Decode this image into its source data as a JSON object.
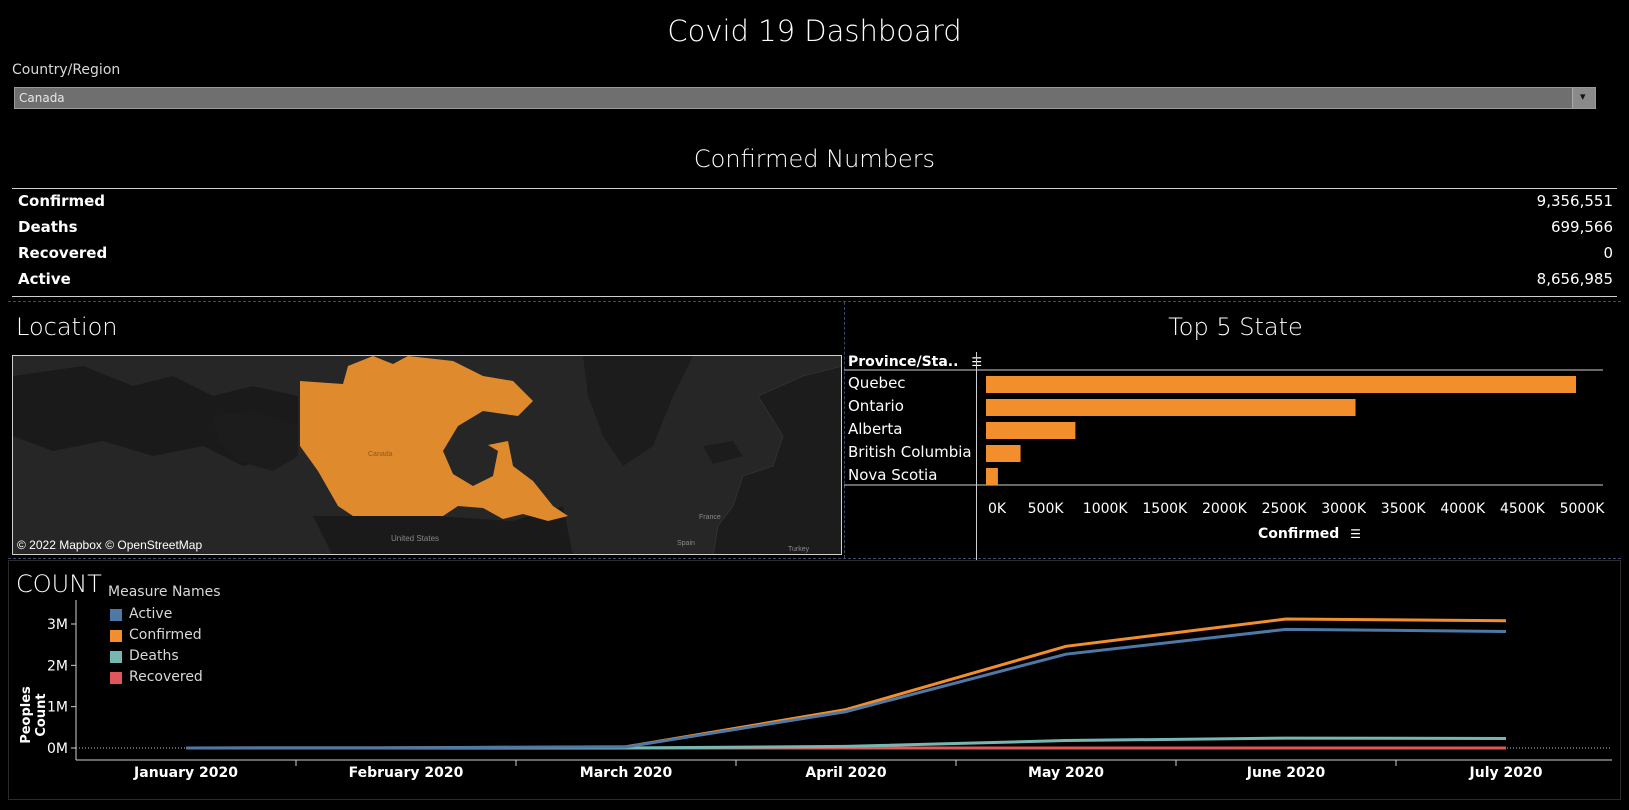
{
  "dashboard": {
    "title": "Covid 19 Dashboard",
    "filter_label": "Country/Region",
    "filter_value": "Canada"
  },
  "kpis": {
    "title": "Confirmed Numbers",
    "rows": [
      {
        "label": "Confirmed",
        "value": "9,356,551"
      },
      {
        "label": "Deaths",
        "value": "699,566"
      },
      {
        "label": "Recovered",
        "value": "0"
      },
      {
        "label": "Active",
        "value": "8,656,985"
      }
    ]
  },
  "location": {
    "title": "Location",
    "map_label": "Canada",
    "map_credit": "© 2022 Mapbox © OpenStreetMap",
    "place_labels": [
      "United States",
      "France",
      "Spain",
      "Turkey"
    ],
    "highlight_color": "#e08a2e"
  },
  "chart_data": [
    {
      "type": "bar",
      "title": "Top 5 State",
      "column_header": "Province/Sta..",
      "xlabel": "Confirmed",
      "categories": [
        "Quebec",
        "Ontario",
        "Alberta",
        "British Columbia",
        "Nova Scotia"
      ],
      "values": [
        4950000,
        3100000,
        750000,
        290000,
        100000
      ],
      "xlim": [
        0,
        5000000
      ],
      "tick_labels": [
        "0K",
        "500K",
        "1000K",
        "1500K",
        "2000K",
        "2500K",
        "3000K",
        "3500K",
        "4000K",
        "4500K",
        "5000K"
      ],
      "color": "#f28e2b"
    },
    {
      "type": "line",
      "title": "COUNT",
      "ylabel": "Peoples Count",
      "legend_title": "Measure Names",
      "x": [
        "January 2020",
        "February 2020",
        "March 2020",
        "April 2020",
        "May 2020",
        "June 2020",
        "July 2020"
      ],
      "ylim": [
        0,
        3000000
      ],
      "y_tick_labels": [
        "0M",
        "1M",
        "2M",
        "3M"
      ],
      "series": [
        {
          "name": "Active",
          "color": "#4e79a7",
          "values": [
            0,
            5000,
            25000,
            880000,
            2270000,
            2870000,
            2820000
          ]
        },
        {
          "name": "Confirmed",
          "color": "#f28e2b",
          "values": [
            0,
            5000,
            30000,
            930000,
            2460000,
            3120000,
            3080000
          ]
        },
        {
          "name": "Deaths",
          "color": "#76b7b2",
          "values": [
            0,
            0,
            1000,
            40000,
            180000,
            240000,
            230000
          ]
        },
        {
          "name": "Recovered",
          "color": "#e15759",
          "values": [
            0,
            0,
            0,
            0,
            0,
            0,
            0
          ]
        }
      ]
    }
  ]
}
